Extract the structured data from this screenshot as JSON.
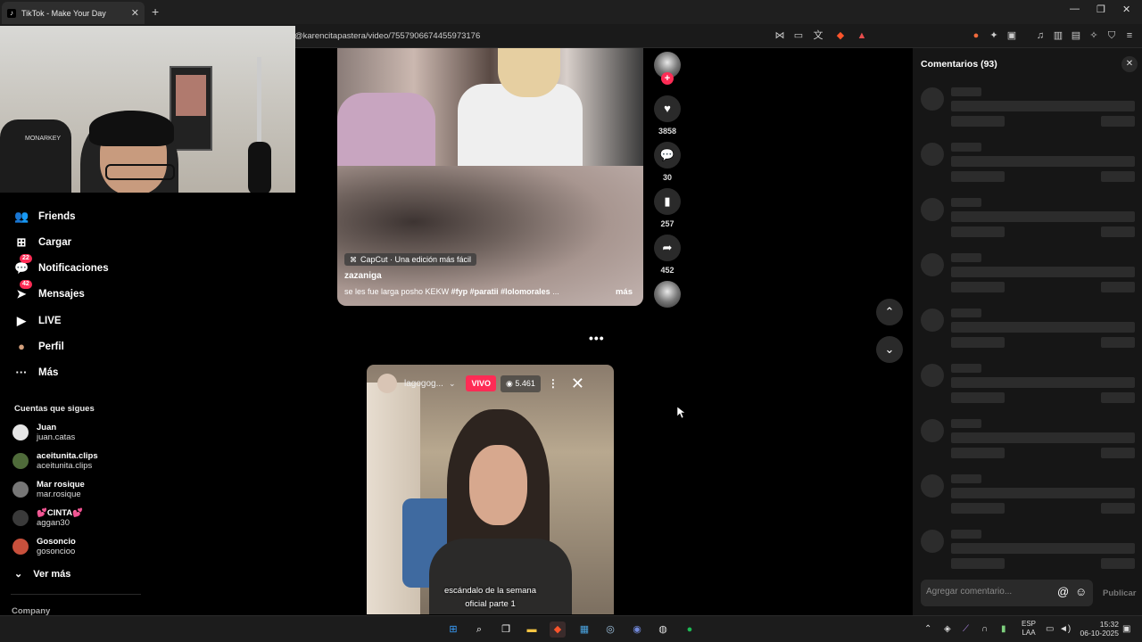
{
  "browser": {
    "tab_title": "TikTok - Make Your Day",
    "tab_favicon": "tiktok-icon",
    "new_tab": "+",
    "tab_close": "✕",
    "url": "@karencitapastera/video/7557906674455973176",
    "window_controls": {
      "minimize": "—",
      "restore": "❐",
      "close": "✕"
    }
  },
  "sidebar": {
    "items": [
      {
        "label": "Friends",
        "icon": "friends-icon",
        "glyph": "👥"
      },
      {
        "label": "Cargar",
        "icon": "upload-icon",
        "glyph": "⊞"
      },
      {
        "label": "Notificaciones",
        "icon": "notifications-icon",
        "glyph": "💬",
        "badge": "22"
      },
      {
        "label": "Mensajes",
        "icon": "messages-icon",
        "glyph": "➤",
        "badge": "42"
      },
      {
        "label": "LIVE",
        "icon": "live-icon",
        "glyph": "▶"
      },
      {
        "label": "Perfil",
        "icon": "profile-icon",
        "glyph": "●"
      },
      {
        "label": "Más",
        "icon": "more-icon",
        "glyph": "···"
      }
    ],
    "following_title": "Cuentas que sigues",
    "following": [
      {
        "name": "Juan",
        "username": "juan.catas",
        "color": "#e6e6e6"
      },
      {
        "name": "aceitunita.clips",
        "username": "aceitunita.clips",
        "color": "#4f6b3a"
      },
      {
        "name": "Mar rosique",
        "username": "mar.rosique",
        "color": "#777777"
      },
      {
        "name": "💕CINTA💕",
        "username": "aggan30",
        "color": "#3a3a3a"
      },
      {
        "name": "Gosoncio",
        "username": "gosoncioo",
        "color": "#c8503c"
      }
    ],
    "see_more": "Ver más",
    "company": "Company"
  },
  "video1": {
    "capcut": "CapCut · Una edición más fácil",
    "author": "zazaniga",
    "caption_text": "se les fue larga posho KEKW",
    "tags": [
      "#fyp",
      "#paratii",
      "#lolomorales"
    ],
    "ellipsis": "...",
    "more": "más"
  },
  "actions": {
    "like_count": "3858",
    "comment_count": "30",
    "save_count": "257",
    "share_count": "452",
    "plus": "+"
  },
  "feed": {
    "more_dots": "•••",
    "up": "⌃",
    "down": "⌄"
  },
  "video2": {
    "username": "lagogog...",
    "live_label": "VIVO",
    "viewers": "5.461",
    "close": "✕",
    "menu": "⋮",
    "subtitle_line1": "escándalo de la semana",
    "subtitle_line2": "oficial parte 1"
  },
  "comments": {
    "title": "Comentarios (93)",
    "close": "✕",
    "placeholder": "Agregar comentario...",
    "at": "@",
    "emoji": "☺",
    "publish": "Publicar"
  },
  "taskbar": {
    "lang_line1": "ESP",
    "lang_line2": "LAA",
    "time": "15:32",
    "date": "06-10-2025"
  },
  "colors": {
    "accent": "#fe2c55",
    "panel": "#161616",
    "skeleton": "#2c2c2c"
  }
}
